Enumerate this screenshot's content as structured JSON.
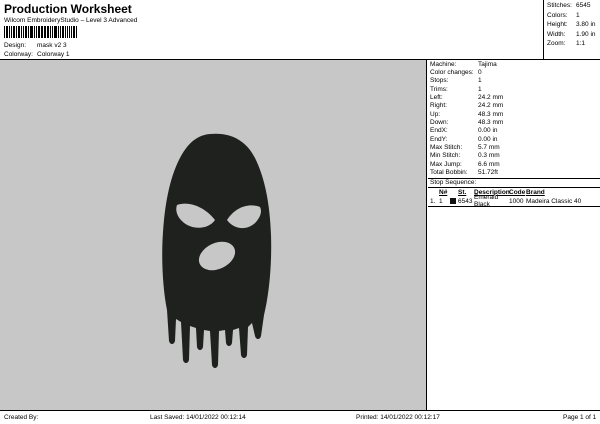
{
  "header": {
    "title": "Production Worksheet",
    "subtitle": "Wilcom EmbroideryStudio – Level 3 Advanced",
    "design_label": "Design:",
    "design_value": "mask v2 3",
    "colorway_label": "Colorway:",
    "colorway_value": "Colorway 1"
  },
  "stats": [
    {
      "label": "Stitches:",
      "value": "6545"
    },
    {
      "label": "Colors:",
      "value": "1"
    },
    {
      "label": "Height:",
      "value": "3.80 in"
    },
    {
      "label": "Width:",
      "value": "1.90 in"
    },
    {
      "label": "Zoom:",
      "value": "1:1"
    }
  ],
  "info": [
    {
      "label": "Machine:",
      "value": "Tajima"
    },
    {
      "label": "Color changes:",
      "value": "0"
    },
    {
      "label": "Stops:",
      "value": "1"
    },
    {
      "label": "Trims:",
      "value": "1"
    },
    {
      "label": "Left:",
      "value": "24.2 mm"
    },
    {
      "label": "Right:",
      "value": "24.2 mm"
    },
    {
      "label": "Up:",
      "value": "48.3 mm"
    },
    {
      "label": "Down:",
      "value": "48.3 mm"
    },
    {
      "label": "EndX:",
      "value": "0.00 in"
    },
    {
      "label": "EndY:",
      "value": "0.00 in"
    },
    {
      "label": "Max Stitch:",
      "value": "5.7 mm"
    },
    {
      "label": "Min Stitch:",
      "value": "0.3 mm"
    },
    {
      "label": "Max Jump:",
      "value": "6.6 mm"
    },
    {
      "label": "Total Bobbin:",
      "value": "51.72ft"
    }
  ],
  "stop_sequence": {
    "title": "Stop Sequence:",
    "headers": {
      "n": "",
      "num": "N#",
      "st": "St.",
      "desc": "Description",
      "code": "Code",
      "brand": "Brand"
    },
    "rows": [
      {
        "n": "1.",
        "num": "1",
        "color": "#111111",
        "st": "6543",
        "desc": "Emerald Black",
        "code": "1000",
        "brand": "Madeira Classic 40"
      }
    ]
  },
  "footer": {
    "created": "Created By:",
    "saved": "Last Saved: 14/01/2022 00:12:14",
    "printed": "Printed: 14/01/2022 00:12:17",
    "page": "Page 1 of 1"
  },
  "design": {
    "fill": "#1f211f",
    "canvas_bg": "#c7c7c7"
  }
}
